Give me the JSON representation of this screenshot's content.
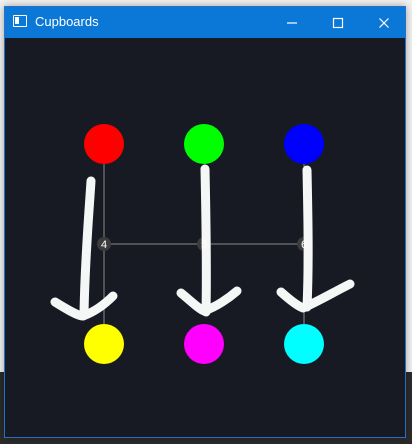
{
  "window": {
    "title": "Cupboards"
  },
  "titlebar_buttons": {
    "minimize": "minimize-icon",
    "maximize": "maximize-icon",
    "close": "close-icon"
  },
  "colors": {
    "titlebar": "#0b78d8",
    "canvas_bg": "#171a23",
    "guide_line": "#8a8a8a",
    "arrow": "#ffffff",
    "node_center": "#3c3c3c"
  },
  "circles": {
    "top": [
      {
        "name": "red",
        "color": "#ff0000"
      },
      {
        "name": "green",
        "color": "#00ff00"
      },
      {
        "name": "blue",
        "color": "#0000ff"
      }
    ],
    "bottom": [
      {
        "name": "yellow",
        "color": "#ffff00"
      },
      {
        "name": "magenta",
        "color": "#ff00ff"
      },
      {
        "name": "cyan",
        "color": "#00ffff"
      }
    ]
  },
  "nodes": [
    {
      "label": "4"
    },
    {
      "label": "5"
    },
    {
      "label": "6"
    }
  ]
}
